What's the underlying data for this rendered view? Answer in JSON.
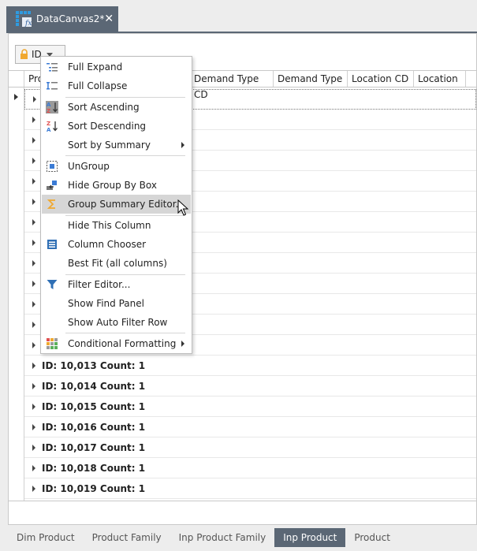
{
  "document_tab": {
    "title": "DataCanvas2*",
    "close": "✕"
  },
  "group_panel": {
    "chip_label": "ID"
  },
  "columns": [
    "Pro",
    "Demand Type CD",
    "Demand Type",
    "Location CD",
    "Location"
  ],
  "groups": [
    "ID: 10,013 Count: 1",
    "ID: 10,014 Count: 1",
    "ID: 10,015 Count: 1",
    "ID: 10,016 Count: 1",
    "ID: 10,017 Count: 1",
    "ID: 10,018 Count: 1",
    "ID: 10,019 Count: 1"
  ],
  "context_menu": {
    "items": [
      {
        "label": "Full Expand",
        "icon": "full-expand-icon"
      },
      {
        "label": "Full Collapse",
        "icon": "full-collapse-icon"
      },
      {
        "label": "Sort Ascending",
        "icon": "sort-ascending-icon"
      },
      {
        "label": "Sort Descending",
        "icon": "sort-descending-icon"
      },
      {
        "label": "Sort by Summary",
        "icon": "",
        "submenu": true
      },
      {
        "label": "UnGroup",
        "icon": "ungroup-icon"
      },
      {
        "label": "Hide Group By Box",
        "icon": "hide-group-box-icon"
      },
      {
        "label": "Group Summary Editor...",
        "icon": "sigma-icon",
        "highlighted": true
      },
      {
        "label": "Hide This Column",
        "icon": ""
      },
      {
        "label": "Column Chooser",
        "icon": "column-chooser-icon"
      },
      {
        "label": "Best Fit (all columns)",
        "icon": ""
      },
      {
        "label": "Filter Editor...",
        "icon": "filter-icon"
      },
      {
        "label": "Show Find Panel",
        "icon": ""
      },
      {
        "label": "Show Auto Filter Row",
        "icon": ""
      },
      {
        "label": "Conditional Formatting",
        "icon": "conditional-formatting-icon",
        "submenu": true
      }
    ]
  },
  "bottom_tabs": [
    "Dim Product",
    "Product Family",
    "Inp Product Family",
    "Inp Product",
    "Product"
  ],
  "active_bottom_tab": "Inp Product",
  "colors": {
    "accent": "#5b6775",
    "highlight": "#d6d6d6"
  }
}
